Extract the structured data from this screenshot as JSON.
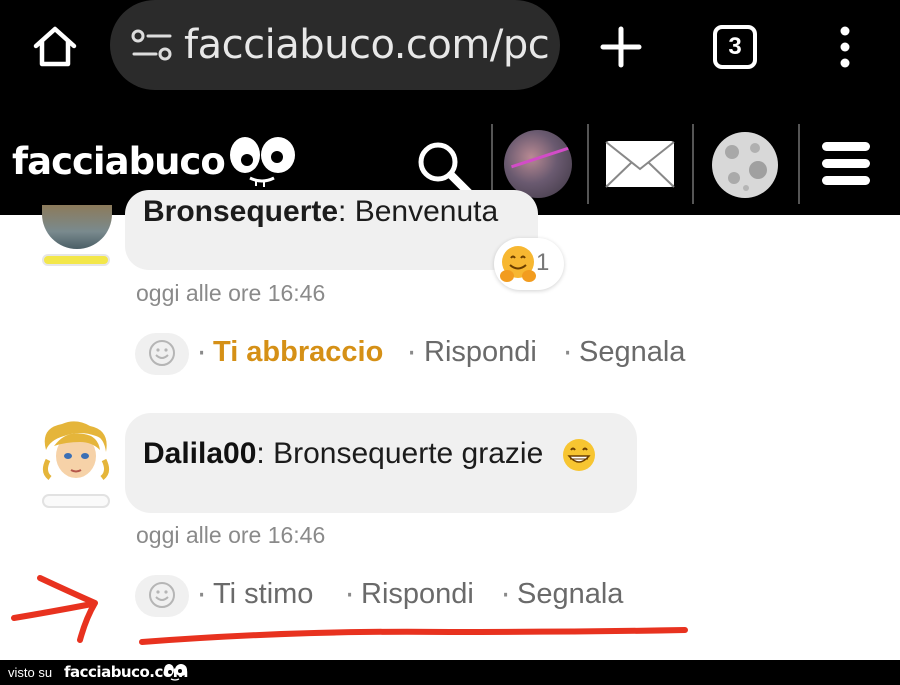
{
  "browser": {
    "url": "facciabuco.com/pc",
    "tab_count": "3"
  },
  "site": {
    "logo": "facciabuco"
  },
  "comments": [
    {
      "author": "Bronsequerte",
      "text": ": Benvenuta",
      "reaction_count": "1",
      "timestamp": "oggi alle ore 16:46",
      "actions": [
        "Ti abbraccio",
        "Rispondi",
        "Segnala"
      ],
      "level_color": "#f3e74a"
    },
    {
      "author": "Dalila00",
      "text": ": Bronsequerte grazie",
      "timestamp": "oggi alle ore 16:46",
      "actions": [
        "Ti stimo",
        "Rispondi",
        "Segnala"
      ]
    }
  ],
  "colors": {
    "accent_gold": "#d59016",
    "annotation_red": "#e8321f"
  },
  "footer": {
    "visto": "visto su",
    "site": "facciabuco.com"
  }
}
